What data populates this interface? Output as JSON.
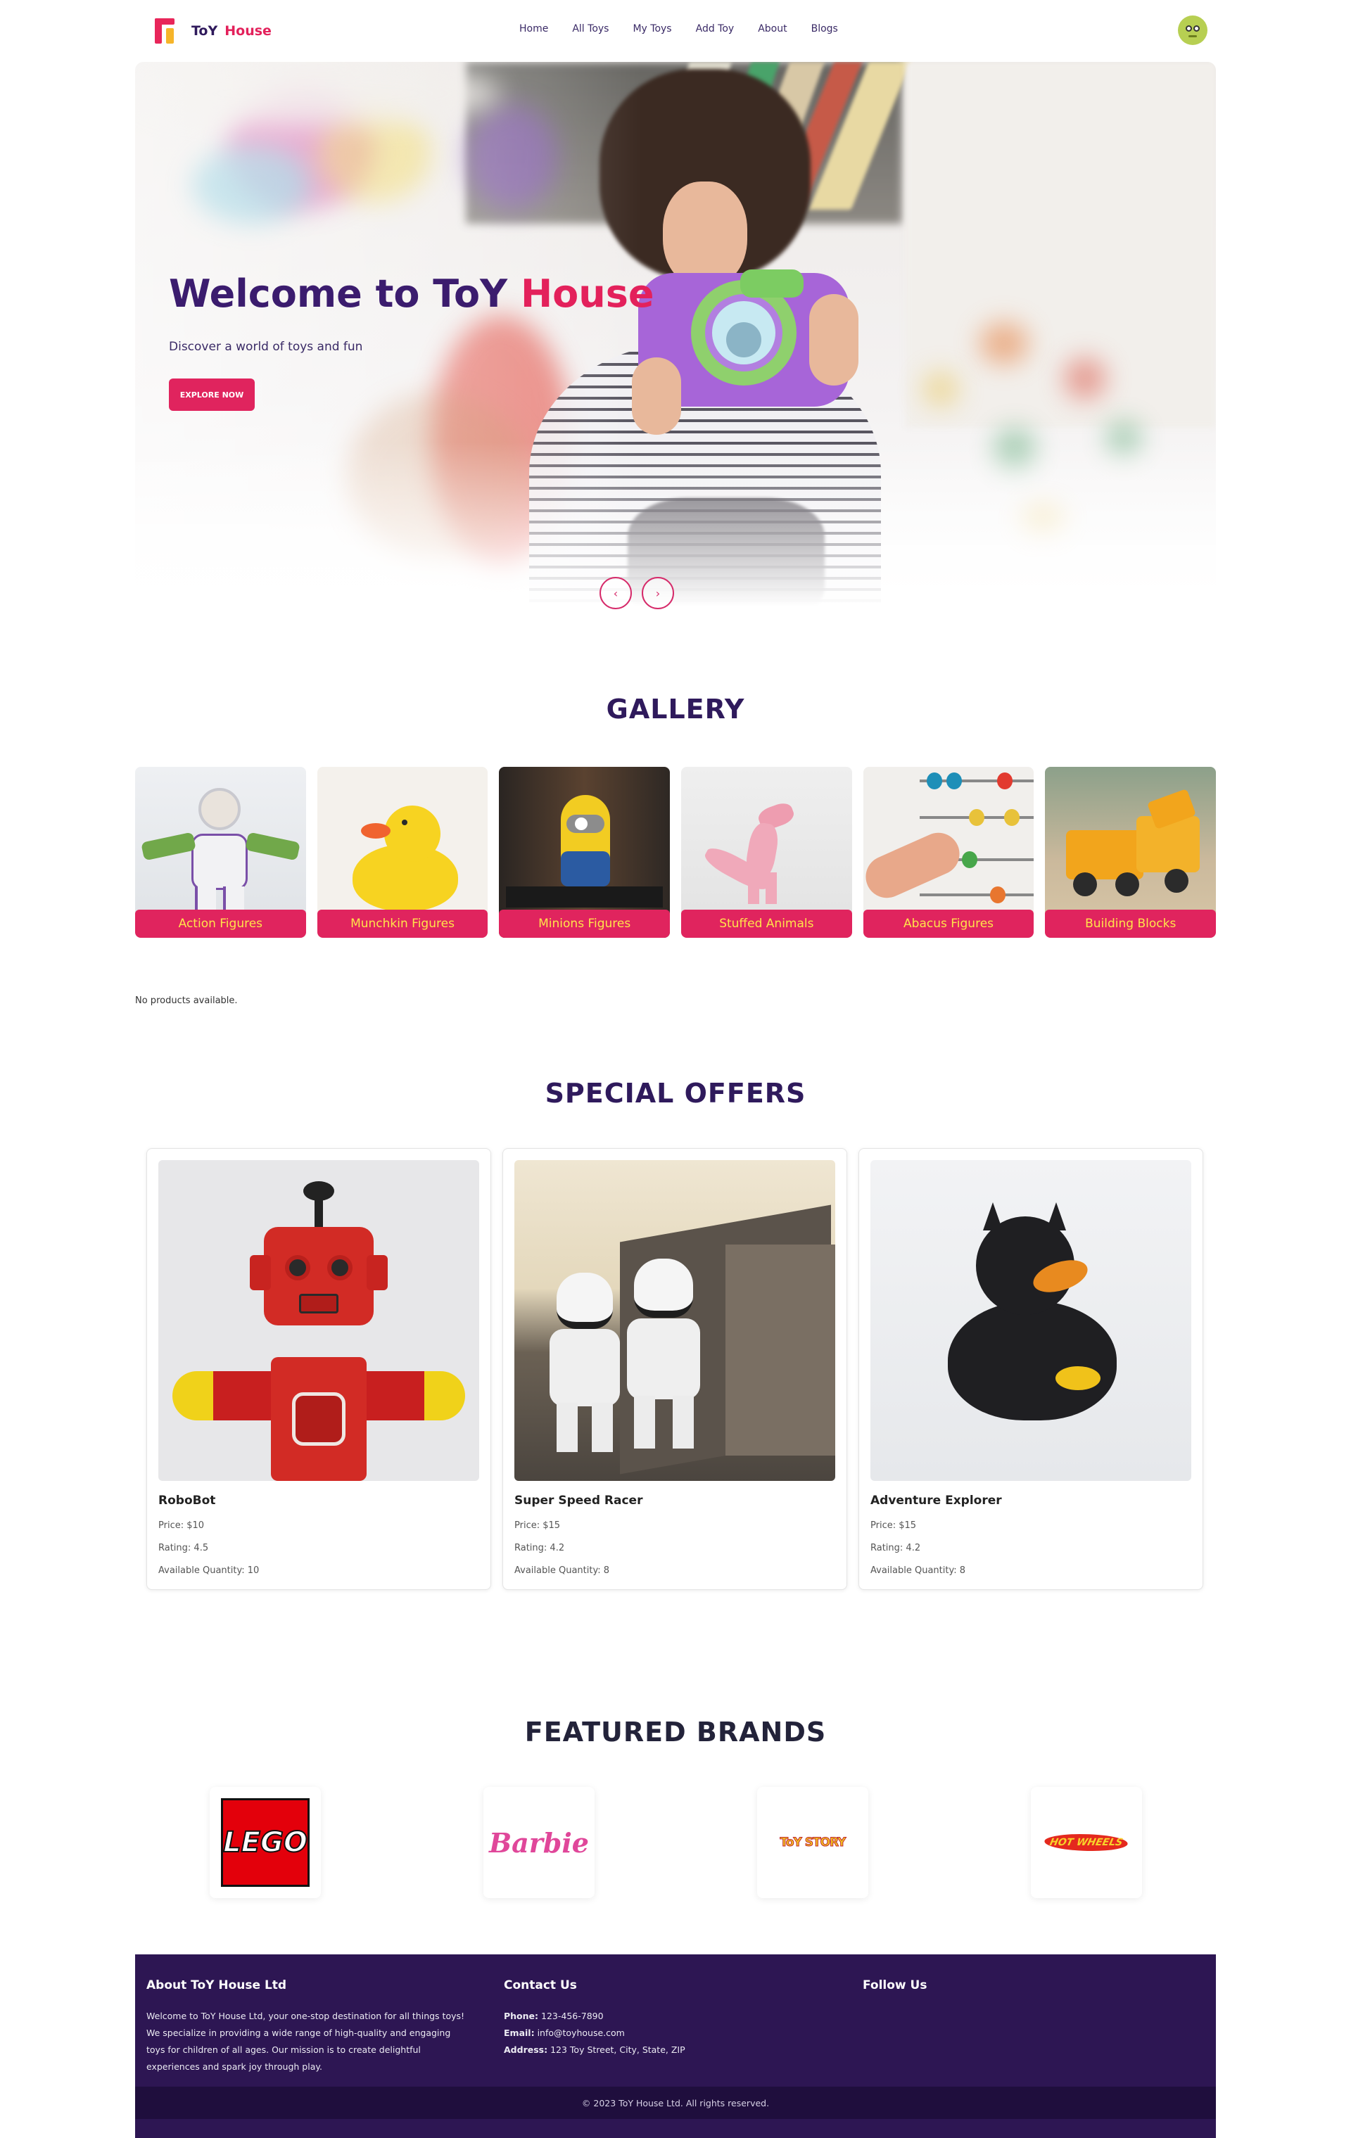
{
  "brand": {
    "name_part1": "ToY",
    "name_part2": "House"
  },
  "nav": {
    "links": [
      "Home",
      "All Toys",
      "My Toys",
      "Add Toy",
      "About",
      "Blogs"
    ]
  },
  "hero": {
    "title_part1": "Welcome to ToY",
    "title_part2": "House",
    "subtitle": "Discover a world of toys and fun",
    "button_label": "EXPLORE NOW",
    "prev_icon": "chevron-left-icon",
    "next_icon": "chevron-right-icon",
    "prev_glyph": "‹",
    "next_glyph": "›"
  },
  "gallery": {
    "title": "GALLERY",
    "items": [
      "Action Figures",
      "Munchkin Figures",
      "Minions Figures",
      "Stuffed Animals",
      "Abacus Figures",
      "Building Blocks"
    ]
  },
  "products": {
    "empty_message": "No products available."
  },
  "offers": {
    "title": "SPECIAL OFFERS",
    "items": [
      {
        "name": "RoboBot",
        "price": "Price: $10",
        "rating": "Rating: 4.5",
        "quantity": "Available Quantity: 10"
      },
      {
        "name": "Super Speed Racer",
        "price": "Price: $15",
        "rating": "Rating: 4.2",
        "quantity": "Available Quantity: 8"
      },
      {
        "name": "Adventure Explorer",
        "price": "Price: $15",
        "rating": "Rating: 4.2",
        "quantity": "Available Quantity: 8"
      }
    ]
  },
  "brands": {
    "title": "FEATURED BRANDS",
    "logos": [
      "LEGO",
      "Barbie",
      "ToY STORY",
      "HOT WHEELS"
    ]
  },
  "footer": {
    "about_title": "About ToY House Ltd",
    "about_text": "Welcome to ToY House Ltd, your one-stop destination for all things toys! We specialize in providing a wide range of high-quality and engaging toys for children of all ages. Our mission is to create delightful experiences and spark joy through play.",
    "contact_title": "Contact Us",
    "phone_label": "Phone:",
    "phone": "123-456-7890",
    "email_label": "Email:",
    "email": "info@toyhouse.com",
    "address_label": "Address:",
    "address": "123 Toy Street, City, State, ZIP",
    "follow_title": "Follow Us",
    "copyright": "© 2023 ToY House Ltd. All rights reserved."
  },
  "colors": {
    "primary": "#e0245e",
    "dark": "#2f1a5c",
    "footer": "#2d1653",
    "label_text": "#ffe44a"
  }
}
